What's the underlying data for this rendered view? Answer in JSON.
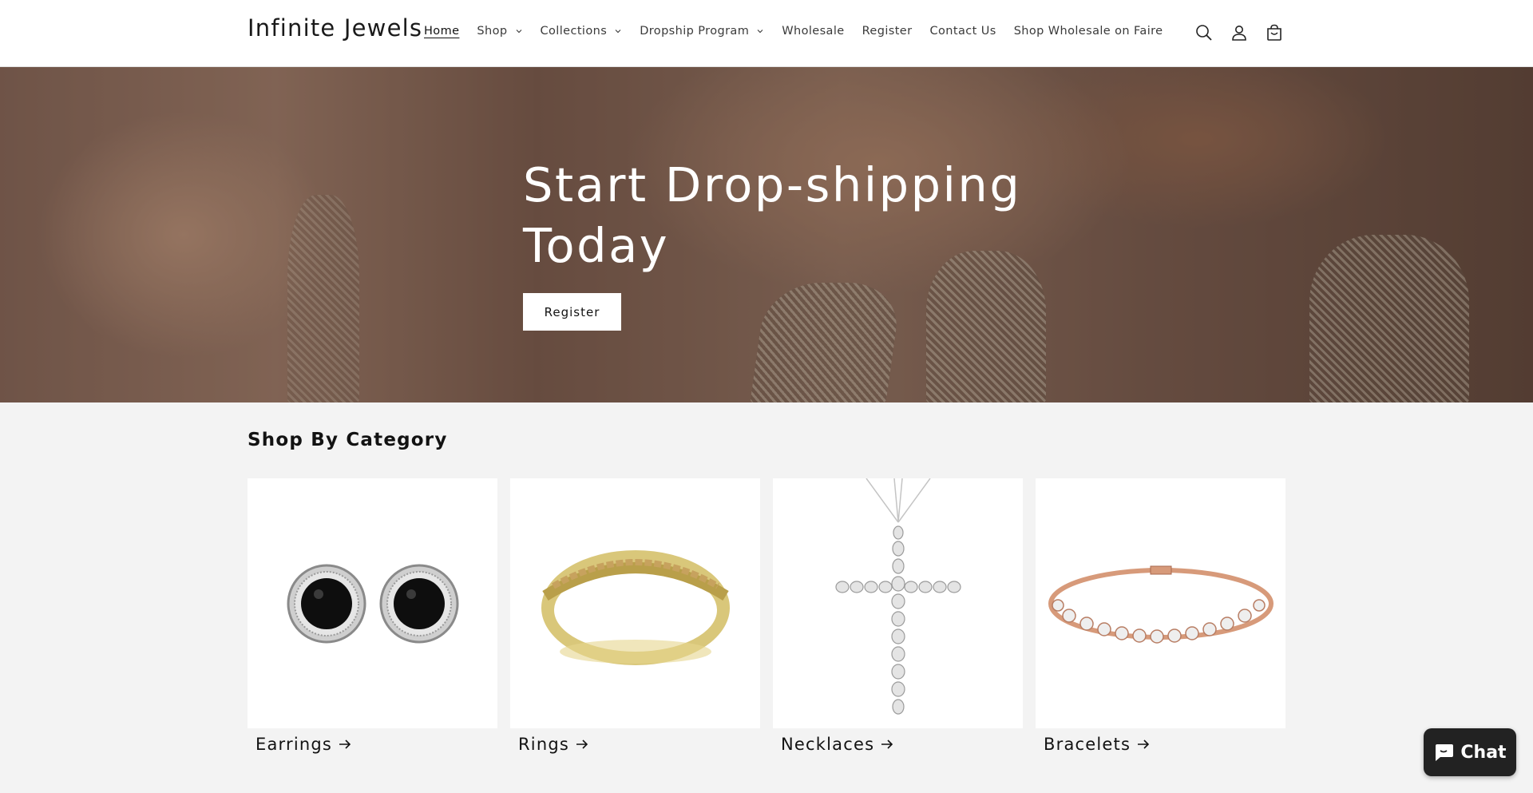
{
  "header": {
    "logo": "Infinite Jewels",
    "nav": [
      {
        "label": "Home",
        "active": true,
        "has_dropdown": false
      },
      {
        "label": "Shop",
        "active": false,
        "has_dropdown": true
      },
      {
        "label": "Collections",
        "active": false,
        "has_dropdown": true
      },
      {
        "label": "Dropship Program",
        "active": false,
        "has_dropdown": true
      },
      {
        "label": "Wholesale",
        "active": false,
        "has_dropdown": false
      },
      {
        "label": "Register",
        "active": false,
        "has_dropdown": false
      },
      {
        "label": "Contact Us",
        "active": false,
        "has_dropdown": false
      },
      {
        "label": "Shop Wholesale on Faire",
        "active": false,
        "has_dropdown": false
      }
    ],
    "icons": [
      "search-icon",
      "account-icon",
      "cart-icon"
    ]
  },
  "hero": {
    "title": "Start Drop-shipping Today",
    "button": "Register"
  },
  "categories": {
    "title": "Shop By Category",
    "items": [
      {
        "label": "Earrings",
        "image": "earrings"
      },
      {
        "label": "Rings",
        "image": "ring"
      },
      {
        "label": "Necklaces",
        "image": "cross-necklace"
      },
      {
        "label": "Bracelets",
        "image": "bracelet"
      }
    ]
  },
  "chat": {
    "label": "Chat"
  },
  "colors": {
    "header_bg": "#ffffff",
    "page_bg": "#f3f3f3",
    "text": "#121212",
    "chat_bg": "#222222"
  }
}
